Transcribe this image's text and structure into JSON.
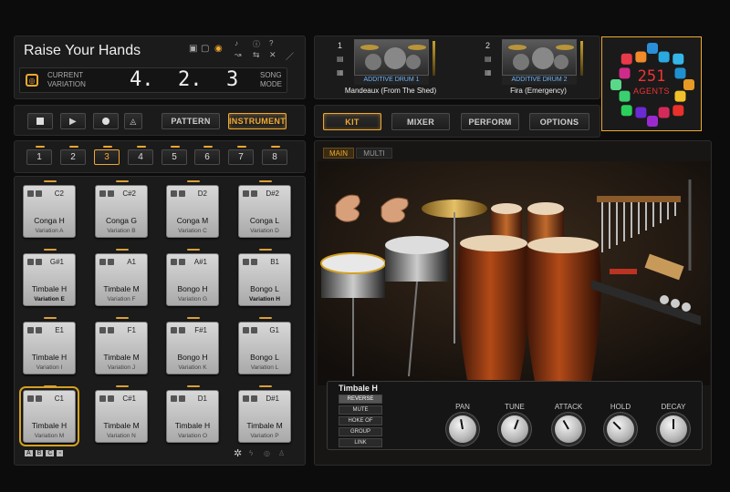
{
  "song": {
    "title": "Raise Your Hands",
    "variation_label_1": "CURRENT",
    "variation_label_2": "VARIATION",
    "position": "4.  2.  3",
    "mode_1": "SONG",
    "mode_2": "MODE"
  },
  "transport": {
    "pattern": "PATTERN",
    "instrument": "INSTRUMENT"
  },
  "numbers": [
    "1",
    "2",
    "3",
    "4",
    "5",
    "6",
    "7",
    "8"
  ],
  "selected_number": "3",
  "pads": [
    {
      "note": "C2",
      "inst": "Conga H",
      "var": "Variation A"
    },
    {
      "note": "C#2",
      "inst": "Conga G",
      "var": "Variation B"
    },
    {
      "note": "D2",
      "inst": "Conga M",
      "var": "Variation C"
    },
    {
      "note": "D#2",
      "inst": "Conga L",
      "var": "Variation D"
    },
    {
      "note": "G#1",
      "inst": "Timbale H",
      "var": "Variation E"
    },
    {
      "note": "A1",
      "inst": "Timbale M",
      "var": "Variation F"
    },
    {
      "note": "A#1",
      "inst": "Bongo H",
      "var": "Variation G"
    },
    {
      "note": "B1",
      "inst": "Bongo L",
      "var": "Variation H"
    },
    {
      "note": "E1",
      "inst": "Timbale H",
      "var": "Variation I"
    },
    {
      "note": "F1",
      "inst": "Timbale M",
      "var": "Variation J"
    },
    {
      "note": "F#1",
      "inst": "Bongo H",
      "var": "Variation K"
    },
    {
      "note": "G1",
      "inst": "Bongo L",
      "var": "Variation L"
    },
    {
      "note": "C1",
      "inst": "Timbale H",
      "var": "Variation M"
    },
    {
      "note": "C#1",
      "inst": "Timbale M",
      "var": "Variation N"
    },
    {
      "note": "D1",
      "inst": "Timbale H",
      "var": "Variation O"
    },
    {
      "note": "D#1",
      "inst": "Timbale M",
      "var": "Variation P"
    }
  ],
  "footer": {
    "letters": [
      "A",
      "B",
      "C"
    ]
  },
  "slots": [
    {
      "num": "1",
      "name": "ADDITIVE DRUM 1",
      "preset": "Mandeaux (From The Shed)"
    },
    {
      "num": "2",
      "name": "ADDITIVE DRUM 2",
      "preset": "Fira (Emergency)"
    }
  ],
  "agents": {
    "count": "251",
    "label": "AGENTS"
  },
  "nav": {
    "kit": "KIT",
    "mixer": "MIXER",
    "perform": "PERFORM",
    "options": "OPTIONS"
  },
  "tabs": {
    "main": "MAIN",
    "multi": "MULTI"
  },
  "instrument_panel": {
    "name": "Timbale H",
    "options": [
      "REVERSE",
      "MUTE",
      "HOKE OF",
      "GROUP",
      "LINK"
    ]
  },
  "knobs": [
    "PAN",
    "TUNE",
    "ATTACK",
    "HOLD",
    "DECAY"
  ],
  "colors": {
    "accent": "#f0a830",
    "panel": "#1b1b1b"
  }
}
